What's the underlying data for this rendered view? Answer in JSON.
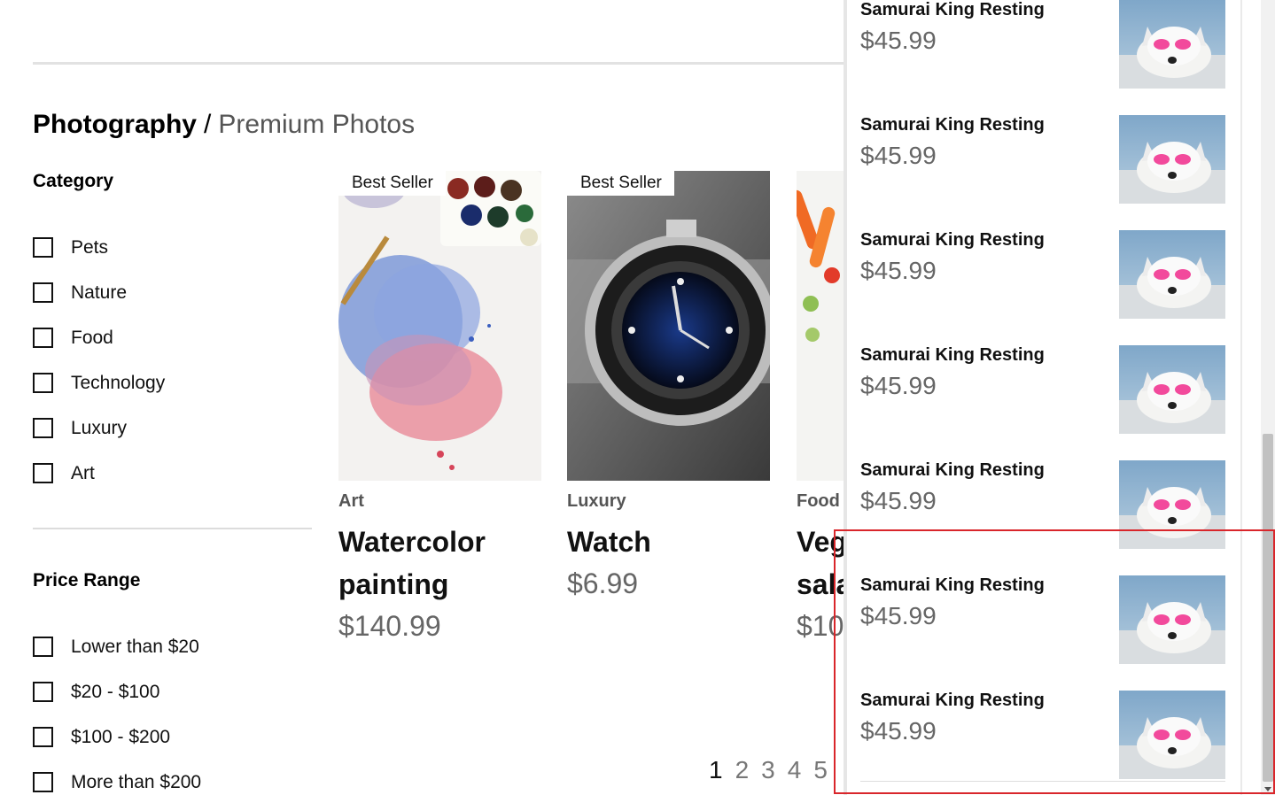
{
  "breadcrumb": {
    "section": "Photography",
    "separator": "/",
    "subsection": "Premium Photos"
  },
  "filters": {
    "category": {
      "heading": "Category",
      "options": [
        "Pets",
        "Nature",
        "Food",
        "Technology",
        "Luxury",
        "Art"
      ]
    },
    "price_range": {
      "heading": "Price Range",
      "options": [
        "Lower than $20",
        "$20 - $100",
        "$100 - $200",
        "More than $200"
      ]
    }
  },
  "products": [
    {
      "badge": "Best Seller",
      "category": "Art",
      "title_line1": "Watercolor",
      "title_line2": "painting",
      "price": "$140.99",
      "image": "watercolor-image"
    },
    {
      "badge": "Best Seller",
      "category": "Luxury",
      "title_line1": "Watch",
      "title_line2": "",
      "price": "$6.99",
      "image": "watch-image"
    },
    {
      "badge": "",
      "category": "Food",
      "title_line1": "Veg",
      "title_line2": "sala",
      "price": "$10",
      "image": "vegetables-image"
    }
  ],
  "pagination": {
    "pages": [
      "1",
      "2",
      "3",
      "4",
      "5"
    ],
    "active": "1"
  },
  "cart": {
    "items": [
      {
        "name": "Samurai King Resting",
        "price": "$45.99",
        "image": "dog-image"
      },
      {
        "name": "Samurai King Resting",
        "price": "$45.99",
        "image": "dog-image"
      },
      {
        "name": "Samurai King Resting",
        "price": "$45.99",
        "image": "dog-image"
      },
      {
        "name": "Samurai King Resting",
        "price": "$45.99",
        "image": "dog-image"
      },
      {
        "name": "Samurai King Resting",
        "price": "$45.99",
        "image": "dog-image"
      },
      {
        "name": "Samurai King Resting",
        "price": "$45.99",
        "image": "dog-image"
      },
      {
        "name": "Samurai King Resting",
        "price": "$45.99",
        "image": "dog-image"
      }
    ]
  },
  "colors": {
    "highlight": "#d9262b",
    "price_gray": "#666666"
  }
}
